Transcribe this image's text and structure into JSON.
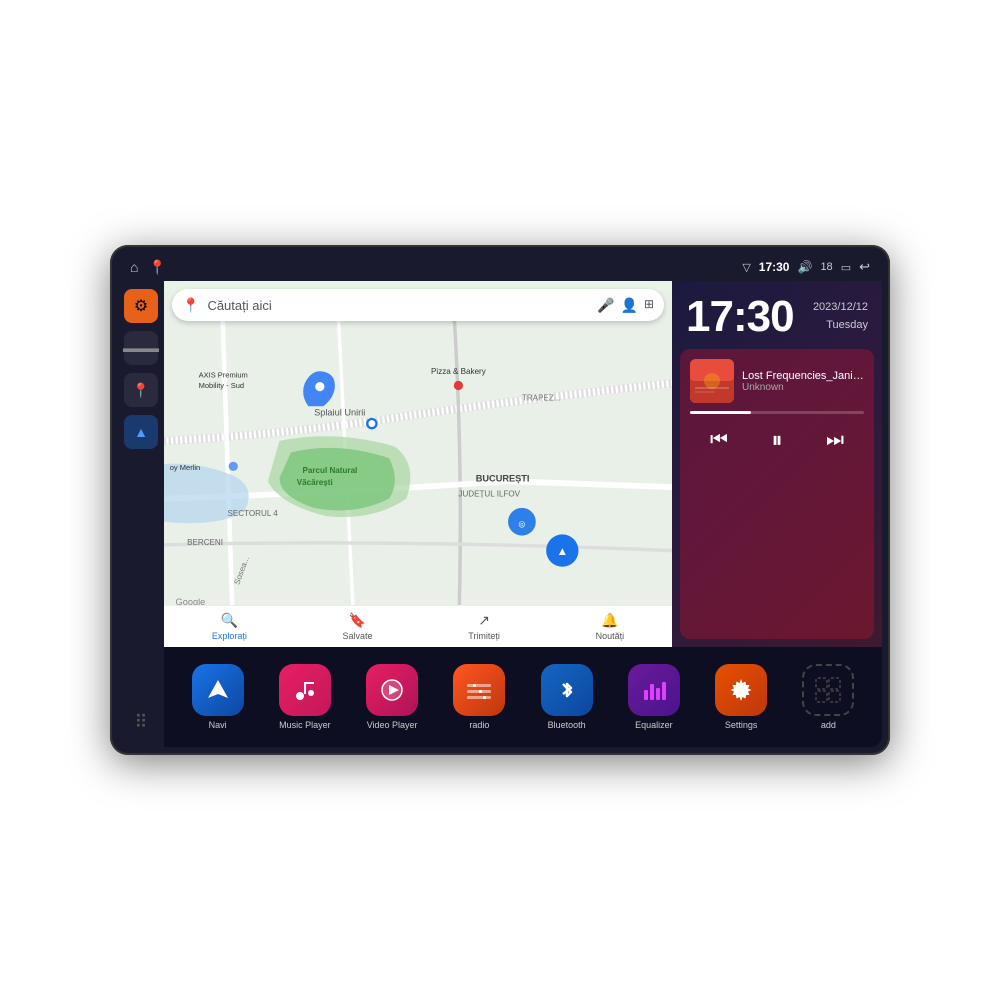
{
  "device": {
    "statusBar": {
      "leftIcons": [
        "⌂",
        "📍"
      ],
      "wifi": "▼",
      "time": "17:30",
      "volume": "🔊",
      "battery_num": "18",
      "battery": "🔋",
      "back": "↩"
    },
    "clock": {
      "time": "17:30",
      "date": "2023/12/12",
      "day": "Tuesday"
    },
    "music": {
      "title": "Lost Frequencies_Janie...",
      "artist": "Unknown"
    },
    "map": {
      "searchPlaceholder": "Căutați aici",
      "navItems": [
        {
          "label": "Explorați",
          "icon": "📍"
        },
        {
          "label": "Salvate",
          "icon": "🔖"
        },
        {
          "label": "Trimiteți",
          "icon": "↗"
        },
        {
          "label": "Noutăți",
          "icon": "🔔"
        }
      ],
      "labels": [
        "AXIS Premium Mobility - Sud",
        "Pizza & Bakery",
        "TRAPEZUL",
        "Parcul Natural Văcărești",
        "BUCUREȘTI SECTORUL 4",
        "BUCUREȘTI",
        "JUDEȚUL ILFOV",
        "BERCENI",
        "oy Merlin"
      ]
    },
    "apps": [
      {
        "label": "Navi",
        "icon": "navi",
        "symbol": "▲"
      },
      {
        "label": "Music Player",
        "icon": "music",
        "symbol": "♪"
      },
      {
        "label": "Video Player",
        "icon": "video",
        "symbol": "▶"
      },
      {
        "label": "radio",
        "icon": "radio",
        "symbol": "📻"
      },
      {
        "label": "Bluetooth",
        "icon": "bluetooth",
        "symbol": "⚡"
      },
      {
        "label": "Equalizer",
        "icon": "equalizer",
        "symbol": "📊"
      },
      {
        "label": "Settings",
        "icon": "settings",
        "symbol": "⚙"
      },
      {
        "label": "add",
        "icon": "add",
        "symbol": "+"
      }
    ],
    "sidebar": [
      {
        "icon": "⚙",
        "class": "orange"
      },
      {
        "icon": "▬",
        "class": "dark"
      },
      {
        "icon": "📍",
        "class": "dark"
      },
      {
        "icon": "▲",
        "class": "nav-arrow"
      }
    ]
  }
}
